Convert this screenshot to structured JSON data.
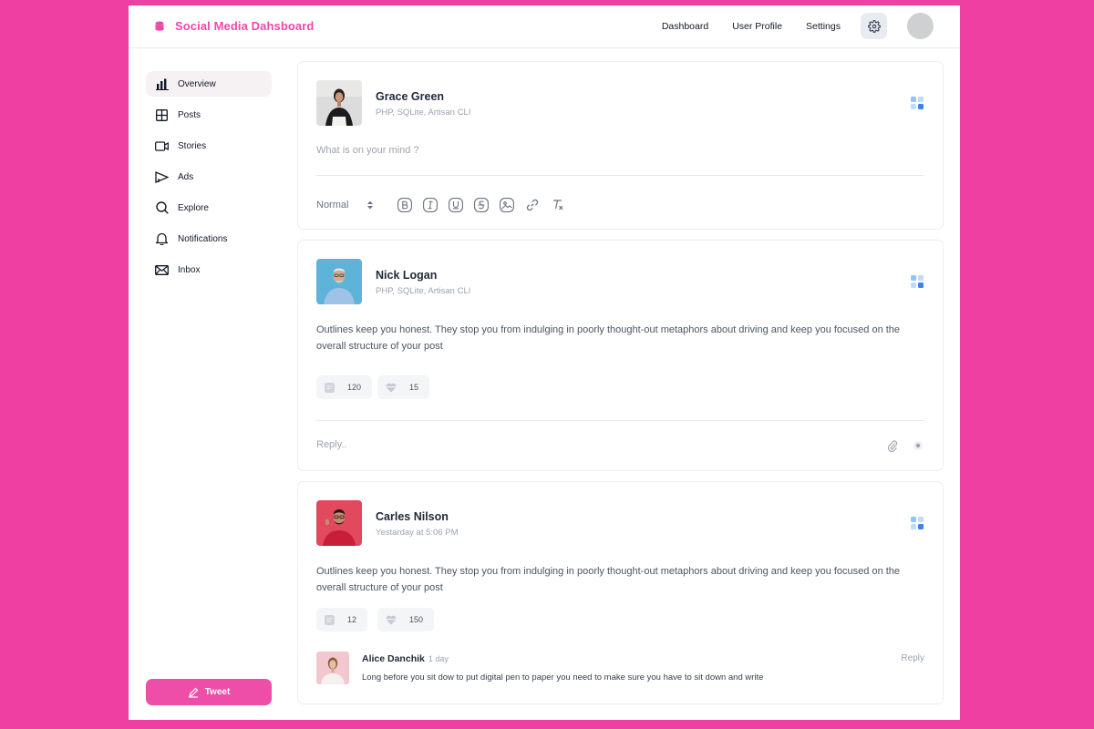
{
  "brand": {
    "name": "Social Media Dahsboard",
    "accent": "#ef48a7"
  },
  "nav": {
    "items": [
      "Dashboard",
      "User Profile",
      "Settings"
    ],
    "settings_icon": "gear-icon"
  },
  "sidebar": {
    "items": [
      {
        "label": "Overview",
        "icon": "bar-chart-icon",
        "active": true
      },
      {
        "label": "Posts",
        "icon": "grid-icon"
      },
      {
        "label": "Stories",
        "icon": "video-icon"
      },
      {
        "label": "Ads",
        "icon": "megaphone-icon"
      },
      {
        "label": "Explore",
        "icon": "search-icon"
      },
      {
        "label": "Notifications",
        "icon": "bell-icon"
      },
      {
        "label": "Inbox",
        "icon": "mail-icon"
      }
    ],
    "tweet_label": "Tweet"
  },
  "composer": {
    "user": "Grace Green",
    "subtitle": "PHP, SQLite, Artisan CLI",
    "placeholder": "What is on your mind ?",
    "text_style": "Normal",
    "tools": [
      "bold-icon",
      "italic-icon",
      "underline-icon",
      "strikethrough-icon",
      "image-icon",
      "link-icon",
      "clear-format-icon"
    ]
  },
  "posts": [
    {
      "user": "Nick Logan",
      "subtitle": "PHP, SQLite, Artisan CLI",
      "text": "Outlines keep you honest. They stop you from indulging in poorly thought-out metaphors about driving and keep you focused on the overall structure of your post",
      "comments": "120",
      "likes": "15",
      "reply_placeholder": "Reply.."
    },
    {
      "user": "Carles Nilson",
      "subtitle": "Yestarday at 5:06 PM",
      "text": "Outlines keep you honest. They stop you from indulging in poorly thought-out metaphors about driving and keep you focused on the overall structure of your post",
      "comments": "12",
      "likes": "150",
      "comment": {
        "user": "Alice Danchik",
        "time": "1 day",
        "text": "Long before you sit dow to put digital pen to paper you need to make sure you have to sit down and write",
        "reply_label": "Reply"
      }
    }
  ]
}
